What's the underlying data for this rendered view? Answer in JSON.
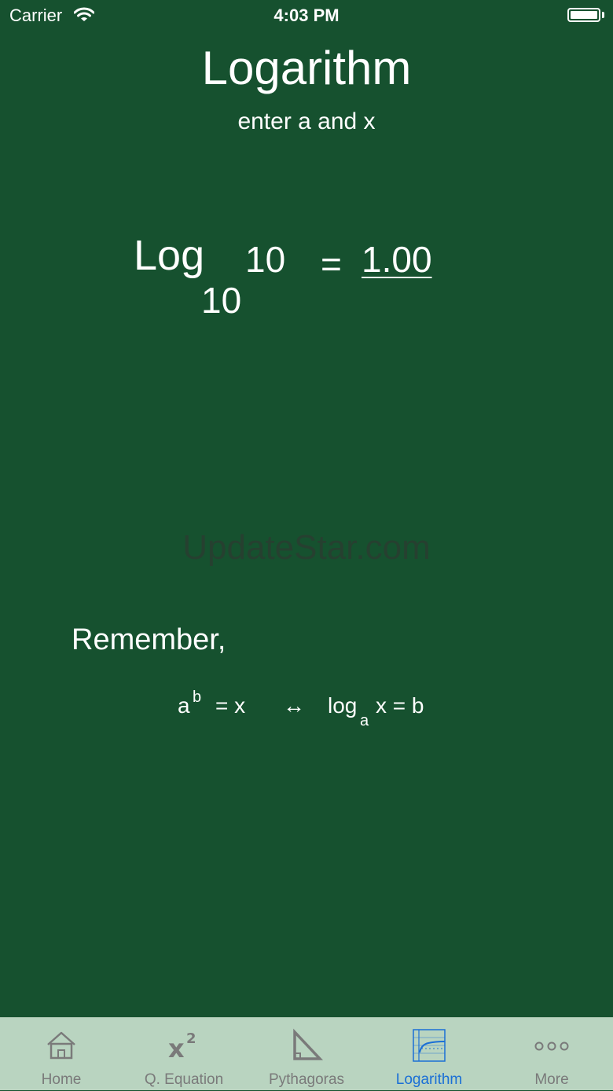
{
  "status_bar": {
    "carrier": "Carrier",
    "time": "4:03 PM"
  },
  "header": {
    "title": "Logarithm",
    "subtitle": "enter a and x"
  },
  "calculator": {
    "log_word": "Log",
    "base": "10",
    "x": "10",
    "equals": "=",
    "result": "1.00"
  },
  "watermark": "UpdateStar.com",
  "reminder": {
    "heading": "Remember,",
    "formula": {
      "left_base": "a",
      "left_exponent": "b",
      "left_rhs": "= x",
      "arrow": "↔",
      "log": "log",
      "log_base": "a",
      "right_rhs": "x = b"
    }
  },
  "tab_bar": {
    "tabs": [
      {
        "label": "Home",
        "icon": "home-icon",
        "active": false
      },
      {
        "label": "Q. Equation",
        "icon": "x-squared-icon",
        "active": false
      },
      {
        "label": "Pythagoras",
        "icon": "triangle-icon",
        "active": false
      },
      {
        "label": "Logarithm",
        "icon": "log-graph-icon",
        "active": true
      },
      {
        "label": "More",
        "icon": "more-dots-icon",
        "active": false
      }
    ]
  },
  "colors": {
    "background": "#16512f",
    "tab_bar": "#b9d4c0",
    "tab_inactive": "#7a7a7a",
    "tab_active": "#1a6fd6"
  }
}
